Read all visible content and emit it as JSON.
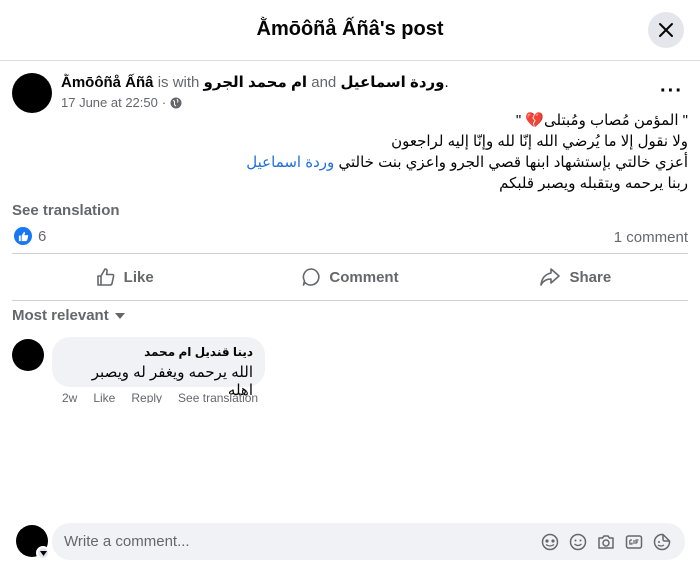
{
  "header": {
    "title": "Ằmōôñå Ấñâ's post"
  },
  "post": {
    "author": "Ằmōôñå Ấñâ",
    "with_text": "is with",
    "tag_1": "ام محمد الجرو",
    "and_text": "and",
    "tag_2": "وردة اسماعيل",
    "period": ".",
    "time": "17 June at 22:50",
    "line_1": "\" المؤمن مُصاب ومُبتلى💔 \"",
    "line_2": "ولا نقول إلا ما يُرضي الله إنّا لله وإنّا إليه لراجعون",
    "line_3_text": "أعزي خالتي بإستشهاد ابنها قصي الجرو واعزي بنت خالتي",
    "line_3_link": "وردة اسماعيل",
    "line_4": "ربنا يرحمه ويتقبله ويصبر قلبكم",
    "see_translation": "See translation",
    "reaction_count": "6",
    "comment_count": "1 comment"
  },
  "actions": {
    "like": "Like",
    "comment": "Comment",
    "share": "Share"
  },
  "comments": {
    "sort_label": "Most relevant",
    "items": [
      {
        "name": "دينا قنديل ام محمد",
        "text": "الله يرحمه ويغفر له ويصبر اهله",
        "age": "2w",
        "like": "Like",
        "reply": "Reply",
        "see_translation": "See translation"
      }
    ]
  },
  "composer": {
    "placeholder": "Write a comment..."
  },
  "colors": {
    "link": "#216fdb",
    "like_blue": "#1877f2",
    "muted": "#65676b",
    "bubble_bg": "#f0f2f5"
  }
}
